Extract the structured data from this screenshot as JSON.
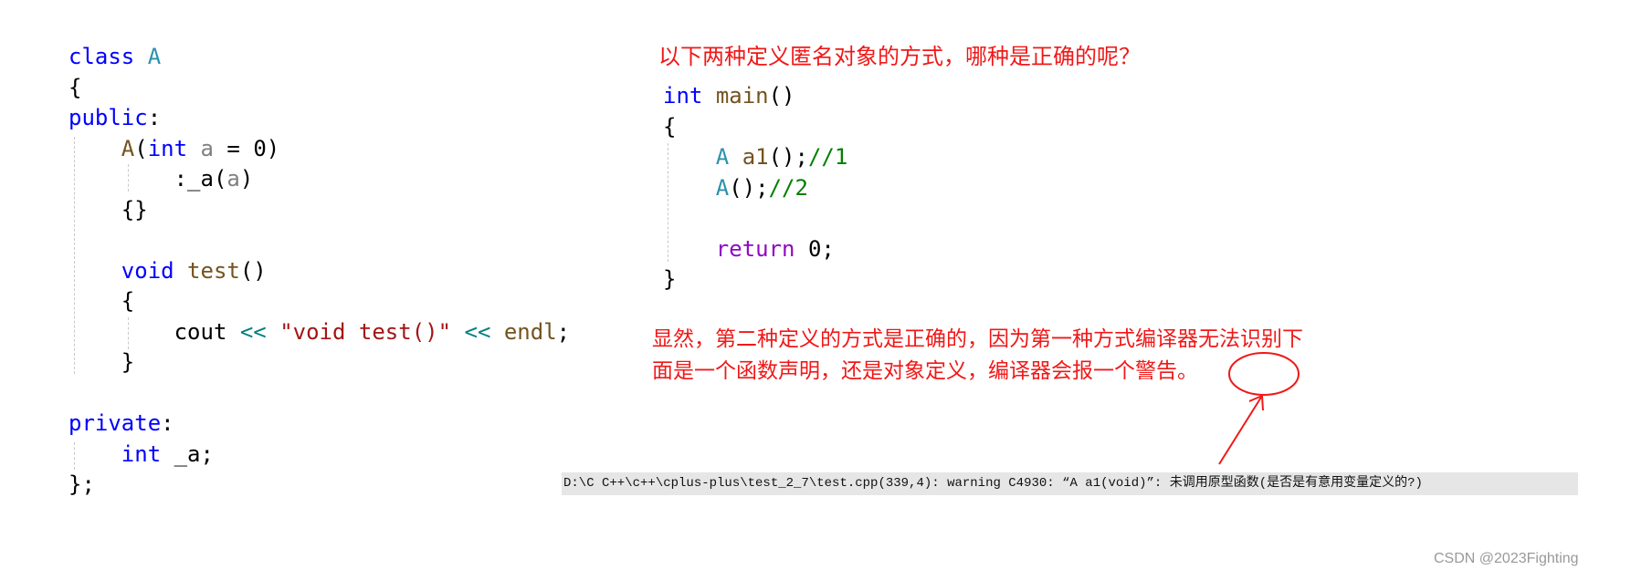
{
  "left_code": [
    [
      [
        "kw",
        "class"
      ],
      [
        "pl",
        " "
      ],
      [
        "cls",
        "A"
      ]
    ],
    [
      [
        "pl",
        "{"
      ]
    ],
    [
      [
        "kw",
        "public"
      ],
      [
        "pl",
        ":"
      ]
    ],
    [
      [
        "pl",
        "    "
      ],
      [
        "fn",
        "A"
      ],
      [
        "pl",
        "("
      ],
      [
        "kw",
        "int"
      ],
      [
        "pl",
        " "
      ],
      [
        "par",
        "a"
      ],
      [
        "pl",
        " = 0)"
      ]
    ],
    [
      [
        "pl",
        "        :_a("
      ],
      [
        "par",
        "a"
      ],
      [
        "pl",
        ")"
      ]
    ],
    [
      [
        "pl",
        "    {}"
      ]
    ],
    [
      [
        "pl",
        ""
      ]
    ],
    [
      [
        "pl",
        "    "
      ],
      [
        "kw",
        "void"
      ],
      [
        "pl",
        " "
      ],
      [
        "fn",
        "test"
      ],
      [
        "pl",
        "()"
      ]
    ],
    [
      [
        "pl",
        "    {"
      ]
    ],
    [
      [
        "pl",
        "        cout "
      ],
      [
        "op",
        "<<"
      ],
      [
        "pl",
        " "
      ],
      [
        "str",
        "\"void test()\""
      ],
      [
        "pl",
        " "
      ],
      [
        "op",
        "<<"
      ],
      [
        "pl",
        " "
      ],
      [
        "fn",
        "endl"
      ],
      [
        "pl",
        ";"
      ]
    ],
    [
      [
        "pl",
        "    }"
      ]
    ],
    [
      [
        "pl",
        ""
      ]
    ],
    [
      [
        "kw",
        "private"
      ],
      [
        "pl",
        ":"
      ]
    ],
    [
      [
        "pl",
        "    "
      ],
      [
        "kw",
        "int"
      ],
      [
        "pl",
        " _a;"
      ]
    ],
    [
      [
        "pl",
        "};"
      ]
    ]
  ],
  "right_code": [
    [
      [
        "kw",
        "int"
      ],
      [
        "pl",
        " "
      ],
      [
        "fn",
        "main"
      ],
      [
        "pl",
        "()"
      ]
    ],
    [
      [
        "pl",
        "{"
      ]
    ],
    [
      [
        "pl",
        "    "
      ],
      [
        "cls",
        "A"
      ],
      [
        "pl",
        " "
      ],
      [
        "fn",
        "a1"
      ],
      [
        "pl",
        "();"
      ],
      [
        "cm",
        "//1"
      ]
    ],
    [
      [
        "pl",
        "    "
      ],
      [
        "cls",
        "A"
      ],
      [
        "pl",
        "();"
      ],
      [
        "cm",
        "//2"
      ]
    ],
    [
      [
        "pl",
        ""
      ]
    ],
    [
      [
        "pl",
        "    "
      ],
      [
        "ret",
        "return"
      ],
      [
        "pl",
        " 0;"
      ]
    ],
    [
      [
        "pl",
        "}"
      ]
    ]
  ],
  "question": "以下两种定义匿名对象的方式，哪种是正确的呢？",
  "answer_lines": [
    "显然，第二种定义的方式是正确的，因为第一种方式编译器无法识别下",
    "面是一个函数声明，还是对象定义，编译器会报一个警告。"
  ],
  "warning": "D:\\C C++\\c++\\cplus-plus\\test_2_7\\test.cpp(339,4): warning C4930: “A a1(void)”: 未调用原型函数(是否是有意用变量定义的?)",
  "watermark": "CSDN @2023Fighting",
  "annotation_color": "#f01818"
}
